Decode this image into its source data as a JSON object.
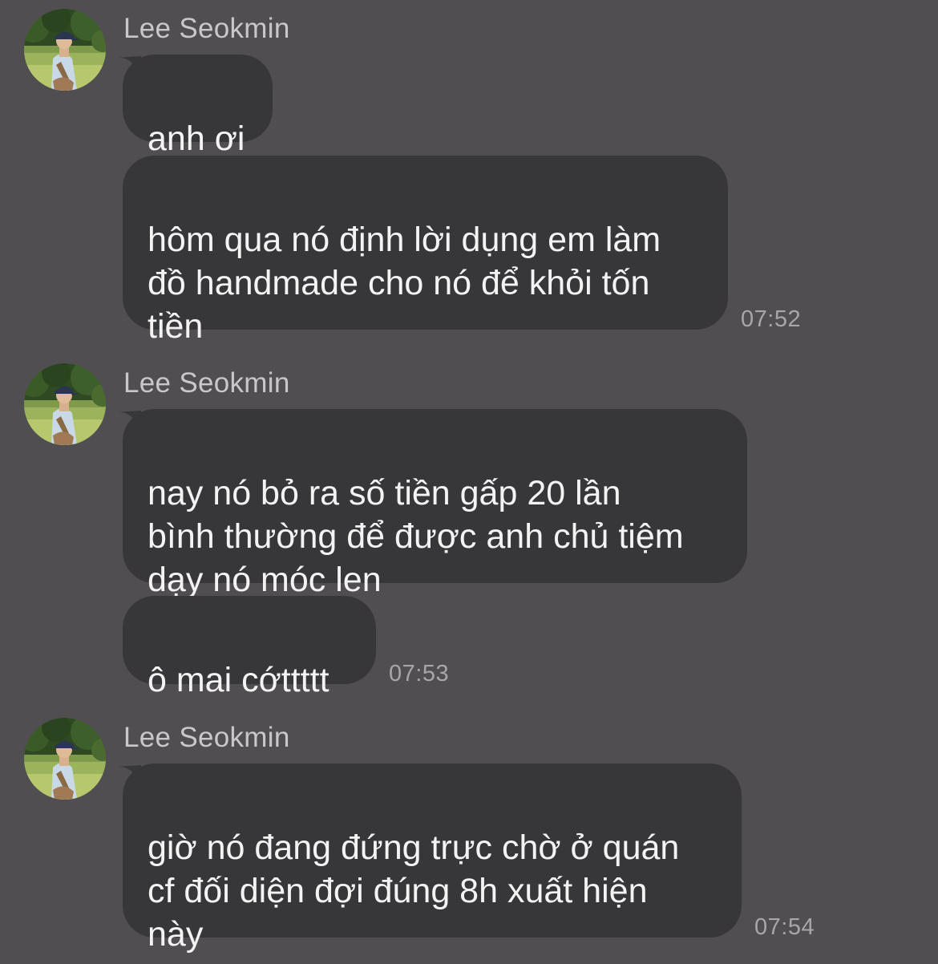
{
  "colors": {
    "background": "#504e50",
    "bubble": "#373638",
    "bubble_text": "#f4f3f4",
    "sender_text": "#c9c7c9",
    "timestamp_text": "#a8a6a8"
  },
  "groups": [
    {
      "sender": "Lee Seokmin",
      "avatar": "profile-photo",
      "messages": [
        {
          "text": "anh ơi"
        },
        {
          "text": "hôm qua nó định lời dụng em làm\nđồ handmade cho nó để khỏi tốn\ntiền"
        }
      ],
      "time": "07:52"
    },
    {
      "sender": "Lee Seokmin",
      "avatar": "profile-photo",
      "messages": [
        {
          "text": "nay nó bỏ ra số tiền gấp 20 lần\nbình thường để được anh chủ tiệm\ndạy nó móc len"
        },
        {
          "text": "ô mai cớttttt"
        }
      ],
      "time": "07:53"
    },
    {
      "sender": "Lee Seokmin",
      "avatar": "profile-photo",
      "messages": [
        {
          "text": "giờ nó đang đứng trực chờ ở quán\ncf đối diện đợi đúng 8h xuất hiện\nnày"
        }
      ],
      "time": "07:54"
    }
  ]
}
